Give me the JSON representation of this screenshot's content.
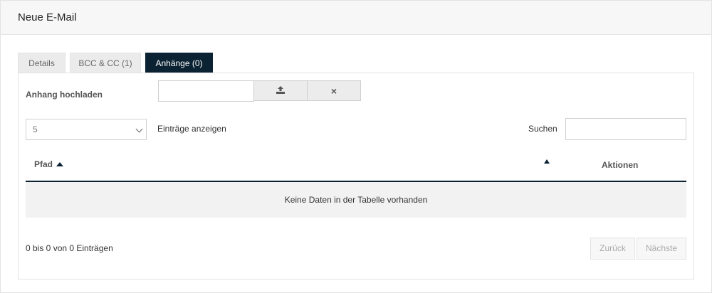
{
  "header": {
    "title": "Neue E-Mail"
  },
  "tabs": [
    {
      "label": "Details",
      "active": false
    },
    {
      "label": "BCC & CC (1)",
      "active": false
    },
    {
      "label": "Anhänge (0)",
      "active": true
    }
  ],
  "upload": {
    "label": "Anhang hochladen",
    "file_value": "",
    "upload_icon": "upload-icon",
    "clear_icon": "close-icon",
    "clear_glyph": "×"
  },
  "table_controls": {
    "page_size_value": "5",
    "page_size_label": "Einträge anzeigen",
    "search_label": "Suchen",
    "search_value": ""
  },
  "table": {
    "columns": [
      "Pfad",
      "",
      "Aktionen"
    ],
    "empty_message": "Keine Daten in der Tabelle vorhanden"
  },
  "footer": {
    "info": "0 bis 0 von 0 Einträgen",
    "prev_label": "Zurück",
    "next_label": "Nächste"
  },
  "colors": {
    "accent": "#0b2233",
    "tab_inactive_bg": "#ebebeb",
    "empty_row_bg": "#f2f2f2"
  }
}
